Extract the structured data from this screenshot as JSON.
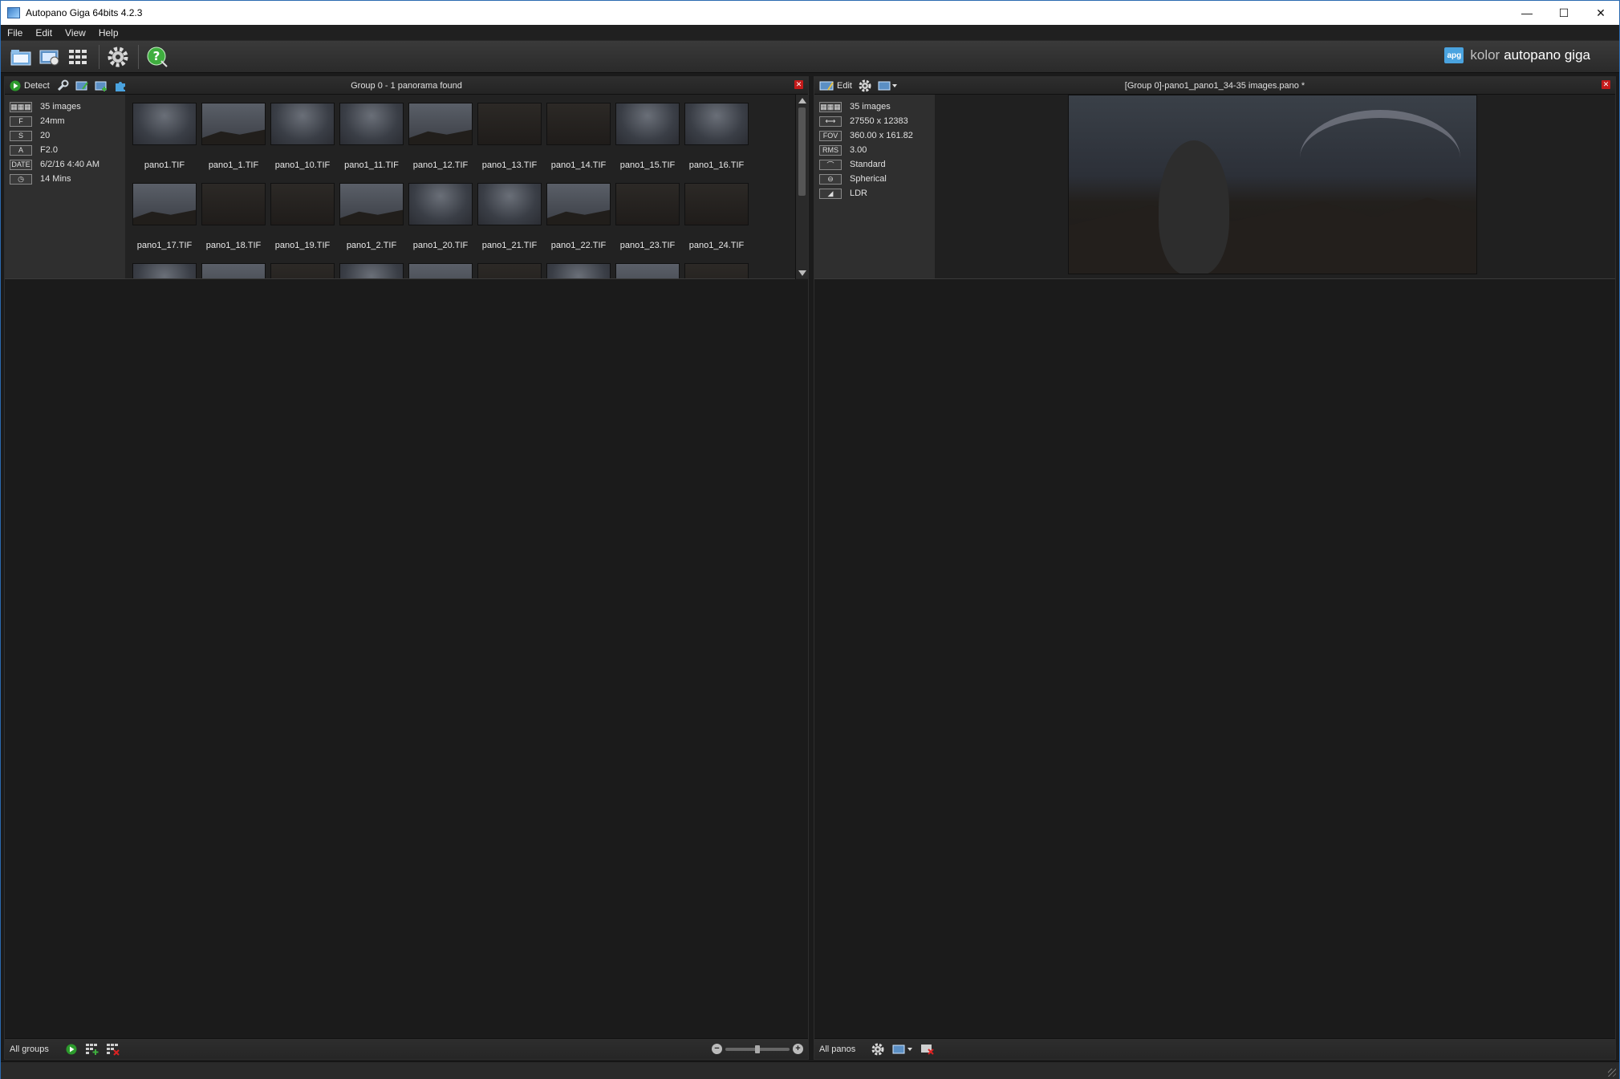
{
  "window": {
    "title": "Autopano Giga 64bits 4.2.3",
    "minimize": "—",
    "maximize": "☐",
    "close": "✕"
  },
  "menu": [
    "File",
    "Edit",
    "View",
    "Help"
  ],
  "toolbar": {
    "buttons": [
      "open-folder-icon",
      "import-images-icon",
      "detect-grid-icon",
      "settings-gear-icon",
      "help-icon"
    ]
  },
  "brand": {
    "badge": "apg",
    "kolor": "kolor",
    "product": "autopano giga"
  },
  "left_panel": {
    "detect_label": "Detect",
    "header_title": "Group 0 - 1 panorama found",
    "info": [
      {
        "badge": "▦▦▦",
        "value": "35 images"
      },
      {
        "badge": "F",
        "value": "24mm"
      },
      {
        "badge": "S",
        "value": "20"
      },
      {
        "badge": "A",
        "value": "F2.0"
      },
      {
        "badge": "DATE",
        "value": "6/2/16 4:40 AM"
      },
      {
        "badge": "◷",
        "value": "14 Mins"
      }
    ],
    "thumbnails": [
      {
        "name": "pano1.TIF",
        "tone": "sky"
      },
      {
        "name": "pano1_1.TIF",
        "tone": "mix"
      },
      {
        "name": "pano1_10.TIF",
        "tone": "sky"
      },
      {
        "name": "pano1_11.TIF",
        "tone": "sky"
      },
      {
        "name": "pano1_12.TIF",
        "tone": "mix"
      },
      {
        "name": "pano1_13.TIF",
        "tone": "dark"
      },
      {
        "name": "pano1_14.TIF",
        "tone": "dark"
      },
      {
        "name": "pano1_15.TIF",
        "tone": "sky"
      },
      {
        "name": "pano1_16.TIF",
        "tone": "sky"
      },
      {
        "name": "pano1_17.TIF",
        "tone": "mix"
      },
      {
        "name": "pano1_18.TIF",
        "tone": "dark"
      },
      {
        "name": "pano1_19.TIF",
        "tone": "dark"
      },
      {
        "name": "pano1_2.TIF",
        "tone": "mix"
      },
      {
        "name": "pano1_20.TIF",
        "tone": "sky"
      },
      {
        "name": "pano1_21.TIF",
        "tone": "sky"
      },
      {
        "name": "pano1_22.TIF",
        "tone": "mix"
      },
      {
        "name": "pano1_23.TIF",
        "tone": "dark"
      },
      {
        "name": "pano1_24.TIF",
        "tone": "dark"
      }
    ],
    "footer_label": "All groups"
  },
  "right_panel": {
    "edit_label": "Edit",
    "header_title": "[Group 0]-pano1_pano1_34-35 images.pano *",
    "info": [
      {
        "badge": "▦▦▦",
        "value": "35 images"
      },
      {
        "badge": "⟷",
        "value": "27550 x 12383"
      },
      {
        "badge": "FOV",
        "value": "360.00 x 161.82"
      },
      {
        "badge": "RMS",
        "value": "3.00"
      },
      {
        "badge": "⌒",
        "value": "Standard"
      },
      {
        "badge": "⊖",
        "value": "Spherical"
      },
      {
        "badge": "◢",
        "value": "LDR"
      }
    ],
    "footer_label": "All panos"
  }
}
